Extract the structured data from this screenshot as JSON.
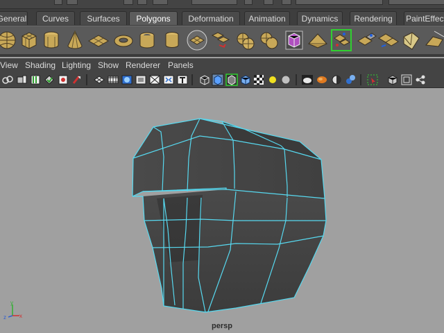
{
  "shelf_tabs": [
    {
      "label": "General",
      "active": false
    },
    {
      "label": "Curves",
      "active": false
    },
    {
      "label": "Surfaces",
      "active": false
    },
    {
      "label": "Polygons",
      "active": true
    },
    {
      "label": "Deformation",
      "active": false
    },
    {
      "label": "Animation",
      "active": false
    },
    {
      "label": "Dynamics",
      "active": false
    },
    {
      "label": "Rendering",
      "active": false
    },
    {
      "label": "PaintEffects",
      "active": false
    }
  ],
  "shelf_icons": [
    "poly-sphere-icon",
    "poly-cube-icon",
    "poly-cylinder-icon",
    "poly-cone-icon",
    "poly-plane-icon",
    "poly-torus-icon",
    "poly-pipe-icon",
    "combine-icon",
    "separate-icon",
    "extract-icon",
    "smooth-icon",
    "boolean-icon",
    "mirror-icon",
    "fill-hole-icon",
    "create-polygon-tool-icon",
    "append-to-polygon-icon",
    "split-polygon-tool-icon",
    "extrude-icon",
    "bridge-icon",
    "merge-icon",
    "bevel-icon"
  ],
  "menubar": {
    "view": "View",
    "shading": "Shading",
    "lighting": "Lighting",
    "show": "Show",
    "renderer": "Renderer",
    "panels": "Panels"
  },
  "panel_toolbar_icons": [
    "select-camera-icon",
    "camera-attributes-icon",
    "bookmarks-icon",
    "image-plane-icon",
    "grease-pencil-icon",
    "2d-pan-zoom-icon",
    "grid-icon",
    "film-gate-icon",
    "resolution-gate-icon",
    "gate-mask-icon",
    "field-chart-icon",
    "safe-action-icon",
    "safe-title-icon",
    "wireframe-icon",
    "smooth-shade-icon",
    "wireframe-on-shaded-icon",
    "default-material-icon",
    "textured-icon",
    "use-all-lights-icon",
    "shadows-icon",
    "high-quality-icon",
    "motion-blur-icon",
    "depth-of-field-icon",
    "ambient-occlusion-icon",
    "isolate-select-icon",
    "xray-icon",
    "xray-joints-icon",
    "xray-components-icon"
  ],
  "viewport": {
    "camera": "persp"
  },
  "axes": {
    "x": "x",
    "y": "y",
    "z": "z"
  },
  "colors": {
    "wire": "#57d9f0",
    "tab_active": "#5c5c5c",
    "viewport_bg": "#a0a0a0"
  }
}
